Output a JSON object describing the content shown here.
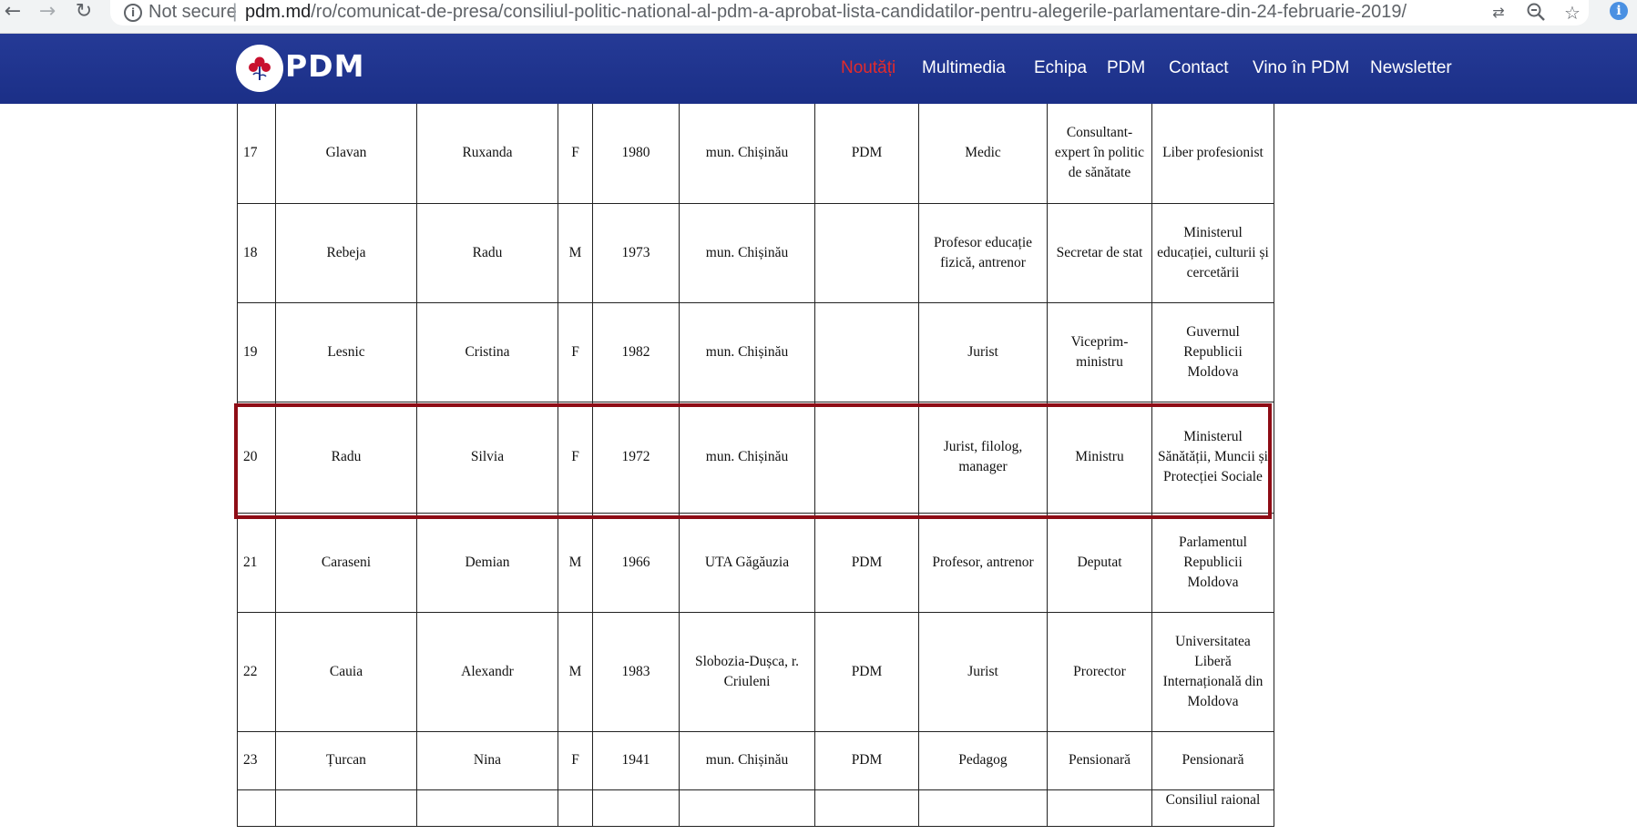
{
  "browser": {
    "security_label": "Not secure",
    "url_host": "pdm.md",
    "url_path": "/ro/comunicat-de-presa/consiliul-politic-national-al-pdm-a-aprobat-lista-candidatilor-pentru-alegerile-parlamentare-din-24-februarie-2019/",
    "icons": [
      "back-arrow-icon",
      "forward-arrow-icon",
      "reload-icon",
      "info-icon",
      "translate-icon",
      "zoom-out-icon",
      "bookmark-star-icon",
      "extension-icon"
    ]
  },
  "site": {
    "logo_text": "PDM",
    "nav": [
      {
        "label": "Noutăți",
        "active": true
      },
      {
        "label": "Multimedia"
      },
      {
        "label": "Echipa"
      },
      {
        "label": "PDM"
      },
      {
        "label": "Contact"
      },
      {
        "label": "Vino în PDM"
      },
      {
        "label": "Newsletter"
      }
    ],
    "colors": {
      "header": "#1f338c",
      "active_nav": "#e32b2b",
      "highlight_border": "#8e0c15"
    }
  },
  "table": {
    "rows": [
      [
        "17",
        "Glavan",
        "Ruxanda",
        "F",
        "1980",
        "mun. Chișinău",
        "PDM",
        "Medic",
        "Consultant-expert în politic de sănătate",
        "Liber profesionist"
      ],
      [
        "18",
        "Rebeja",
        "Radu",
        "M",
        "1973",
        "mun. Chișinău",
        "",
        "Profesor educație fizică, antrenor",
        "Secretar de stat",
        "Ministerul educației, culturii și cercetării"
      ],
      [
        "19",
        "Lesnic",
        "Cristina",
        "F",
        "1982",
        "mun. Chișinău",
        "",
        "Jurist",
        "Viceprim-ministru",
        "Guvernul Republicii Moldova"
      ],
      [
        "20",
        "Radu",
        "Silvia",
        "F",
        "1972",
        "mun. Chișinău",
        "",
        "Jurist, filolog, manager",
        "Ministru",
        "Ministerul Sănătății, Muncii și Protecției Sociale"
      ],
      [
        "21",
        "Caraseni",
        "Demian",
        "M",
        "1966",
        "UTA Găgăuzia",
        "PDM",
        "Profesor, antrenor",
        "Deputat",
        "Parlamentul Republicii Moldova"
      ],
      [
        "22",
        "Cauia",
        "Alexandr",
        "M",
        "1983",
        "Slobozia-Dușca, r. Criuleni",
        "PDM",
        "Jurist",
        "Prorector",
        "Universitatea Liberă Internațională din Moldova"
      ],
      [
        "23",
        "Țurcan",
        "Nina",
        "F",
        "1941",
        "mun. Chișinău",
        "PDM",
        "Pedagog",
        "Pensionară",
        "Pensionară"
      ],
      [
        "",
        "",
        "",
        "",
        "",
        "",
        "",
        "",
        "",
        "Consiliul raional"
      ]
    ],
    "highlighted_row": "20"
  }
}
